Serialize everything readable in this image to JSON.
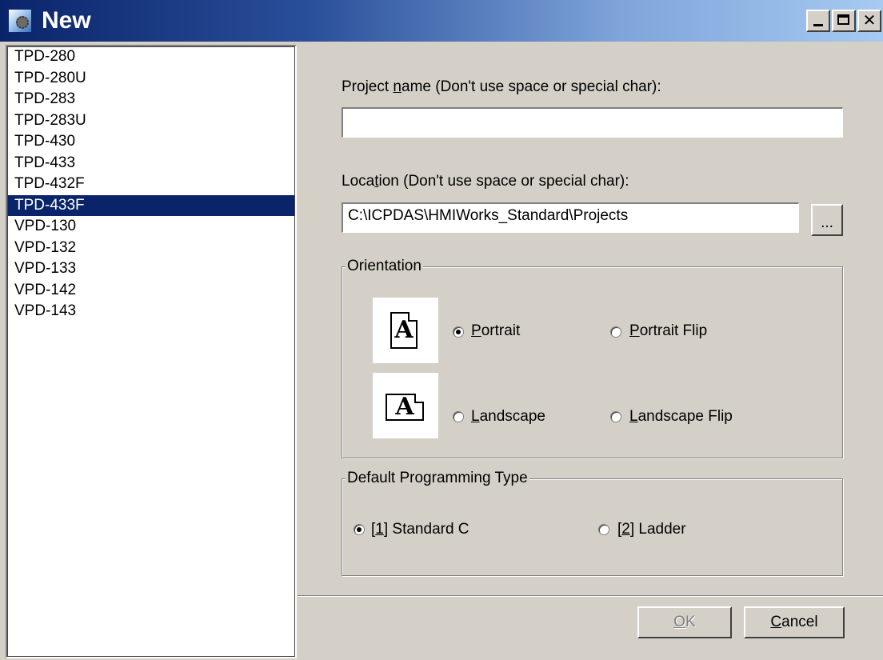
{
  "window": {
    "title": "New"
  },
  "devices": [
    "TPD-280",
    "TPD-280U",
    "TPD-283",
    "TPD-283U",
    "TPD-430",
    "TPD-433",
    "TPD-432F",
    "TPD-433F",
    "VPD-130",
    "VPD-132",
    "VPD-133",
    "VPD-142",
    "VPD-143"
  ],
  "selected_device": "TPD-433F",
  "project_name": {
    "pre": "Project ",
    "key": "n",
    "post": "ame (Don't use space or special char):",
    "value": ""
  },
  "location": {
    "pre": "Loca",
    "key": "t",
    "post": "ion (Don't use space or special char):",
    "value": "C:\\ICPDAS\\HMIWorks_Standard\\Projects",
    "browse_label": "..."
  },
  "orientation": {
    "title": "Orientation",
    "doc_glyph": "A",
    "portrait": {
      "key": "P",
      "rest": "ortrait",
      "checked": true
    },
    "portrait_flip": {
      "key": "P",
      "rest": "ortrait Flip",
      "checked": false
    },
    "landscape": {
      "key": "L",
      "rest": "andscape",
      "checked": false
    },
    "landscape_flip": {
      "key": "L",
      "rest": "andscape Flip",
      "checked": false
    }
  },
  "programming": {
    "title": "Default Programming Type",
    "standard_c": {
      "pre": "[",
      "key": "1",
      "post": "] Standard C",
      "checked": true
    },
    "ladder": {
      "pre": "[",
      "key": "2",
      "post": "] Ladder",
      "checked": false
    }
  },
  "buttons": {
    "ok_key": "O",
    "ok_rest": "K",
    "cancel_key": "C",
    "cancel_rest": "ancel"
  }
}
